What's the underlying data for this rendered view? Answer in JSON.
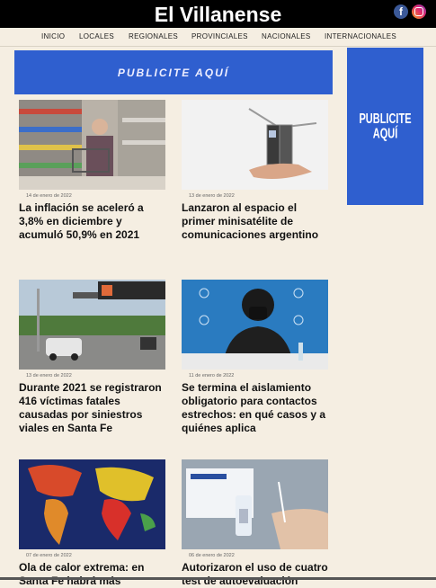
{
  "site": {
    "title": "El Villanense"
  },
  "social": {
    "facebook_icon": "f",
    "instagram_icon": "instagram"
  },
  "nav": {
    "items": [
      "INICIO",
      "LOCALES",
      "REGIONALES",
      "PROVINCIALES",
      "NACIONALES",
      "INTERNACIONALES"
    ]
  },
  "ads": {
    "banner_text": "PUBLICITE AQUÍ",
    "side_text": "PUBLICITE AQUÍ",
    "color": "#2f5fcf"
  },
  "articles": [
    {
      "date": "14 de enero de 2022",
      "headline": "La inflación se aceleró a 3,8% en diciembre y acumuló 50,9% en 2021",
      "image": "supermarket-photo"
    },
    {
      "date": "13 de enero de 2022",
      "headline": "Lanzaron al espacio el primer minisatélite de comunicaciones argentino",
      "image": "satellite-photo"
    },
    {
      "date": "13 de enero de 2022",
      "headline": "Durante 2021 se registraron 416 víctimas fatales causadas por siniestros viales en Santa Fe",
      "image": "highway-photo"
    },
    {
      "date": "11 de enero de 2022",
      "headline": "Se termina el aislamiento obligatorio para contactos estrechos: en qué casos y a quiénes aplica",
      "image": "press-conference-photo"
    },
    {
      "date": "07 de enero de 2022",
      "headline": "Ola de calor extrema: en Santa Fe habrá más",
      "image": "heat-map-photo"
    },
    {
      "date": "06 de enero de 2022",
      "headline": "Autorizaron el uso de cuatro test de autoevaluación",
      "image": "covid-test-photo"
    }
  ]
}
